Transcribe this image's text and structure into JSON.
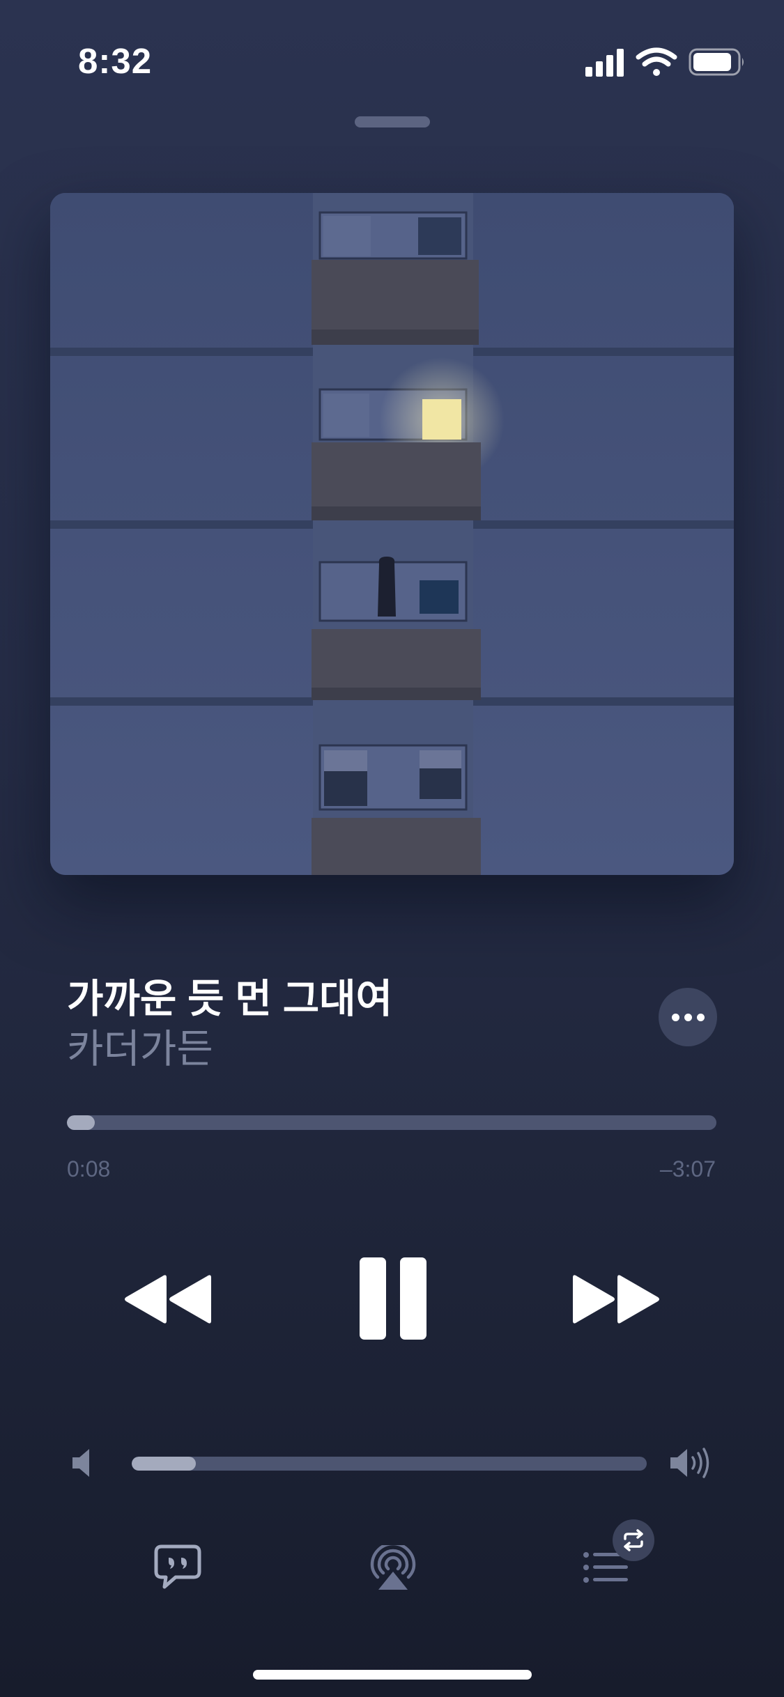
{
  "status_bar": {
    "time": "8:32",
    "icons": [
      "cellular-signal-icon",
      "wifi-icon",
      "battery-icon"
    ]
  },
  "artwork": {
    "icon": "album-artwork-image"
  },
  "track": {
    "title": "가까운 듯 먼 그대여",
    "artist": "카더가든"
  },
  "playback": {
    "elapsed": "0:08",
    "remaining": "–3:07",
    "progress_fraction": 0.043,
    "state": "playing"
  },
  "volume": {
    "level_fraction": 0.125
  },
  "controls": {
    "transport": [
      "rewind-icon",
      "pause-icon",
      "fast-forward-icon"
    ],
    "bottom": [
      "lyrics-icon",
      "airplay-icon",
      "queue-icon",
      "repeat-icon"
    ]
  },
  "colors": {
    "background_top": "#2b3350",
    "background_bottom": "#171c2c",
    "accent_fill": "#a4aabd",
    "track_bg": "#4d5571",
    "secondary_text": "#7c849d",
    "window_light": "#f1e6a4"
  }
}
